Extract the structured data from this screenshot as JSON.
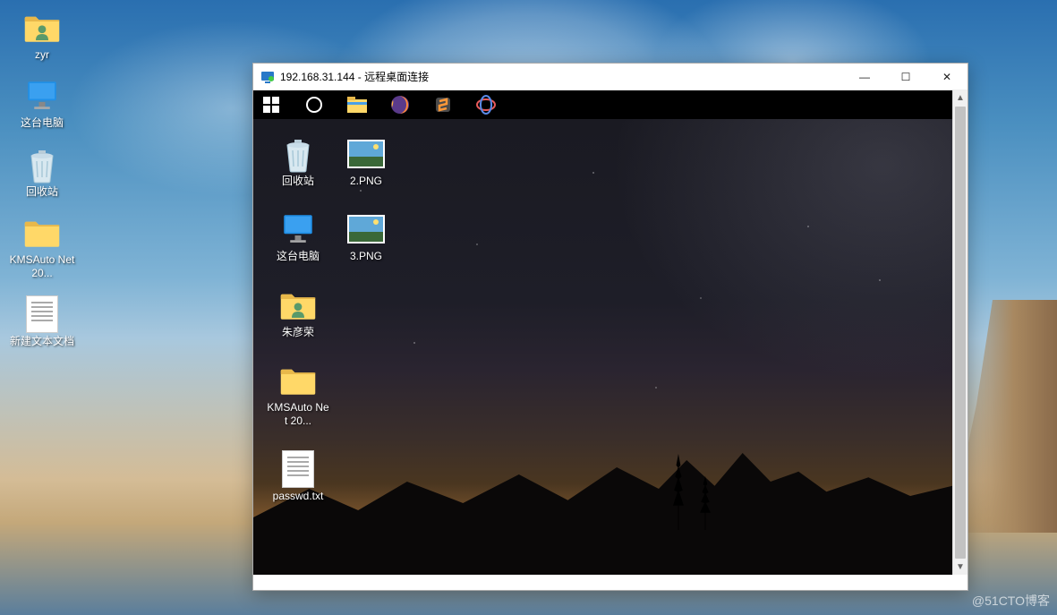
{
  "host": {
    "icons": [
      {
        "id": "user-folder",
        "label": "zyr",
        "type": "folder-user"
      },
      {
        "id": "this-pc",
        "label": "这台电脑",
        "type": "pc"
      },
      {
        "id": "recycle",
        "label": "回收站",
        "type": "recycle"
      },
      {
        "id": "kms",
        "label": "KMSAuto Net 20...",
        "type": "folder"
      },
      {
        "id": "newtxt",
        "label": "新建文本文档",
        "type": "txt"
      }
    ]
  },
  "rdp": {
    "title": "192.168.31.144 - 远程桌面连接",
    "controls": {
      "min": "—",
      "max": "☐",
      "close": "✕"
    },
    "taskbar": [
      {
        "id": "start",
        "name": "windows-start-icon"
      },
      {
        "id": "cortana",
        "name": "cortana-icon"
      },
      {
        "id": "explorer",
        "name": "file-explorer-icon"
      },
      {
        "id": "firefox",
        "name": "firefox-icon"
      },
      {
        "id": "sublime",
        "name": "sublime-icon"
      },
      {
        "id": "app",
        "name": "app-icon"
      }
    ],
    "remote_icons": [
      {
        "id": "r-recycle",
        "label": "回收站",
        "type": "recycle",
        "col": 0
      },
      {
        "id": "r-2png",
        "label": "2.PNG",
        "type": "img",
        "col": 1
      },
      {
        "id": "r-pc",
        "label": "这台电脑",
        "type": "pc",
        "col": 0
      },
      {
        "id": "r-3png",
        "label": "3.PNG",
        "type": "img",
        "col": 1
      },
      {
        "id": "r-user",
        "label": "朱彦荣",
        "type": "folder-user",
        "col": 0
      },
      {
        "id": "r-blank1",
        "label": "",
        "type": "blank",
        "col": 1
      },
      {
        "id": "r-kms",
        "label": "KMSAuto Net 20...",
        "type": "folder",
        "col": 0
      },
      {
        "id": "r-blank2",
        "label": "",
        "type": "blank",
        "col": 1
      },
      {
        "id": "r-passwd",
        "label": "passwd.txt",
        "type": "txt",
        "col": 0
      }
    ]
  },
  "watermark": "@51CTO博客"
}
